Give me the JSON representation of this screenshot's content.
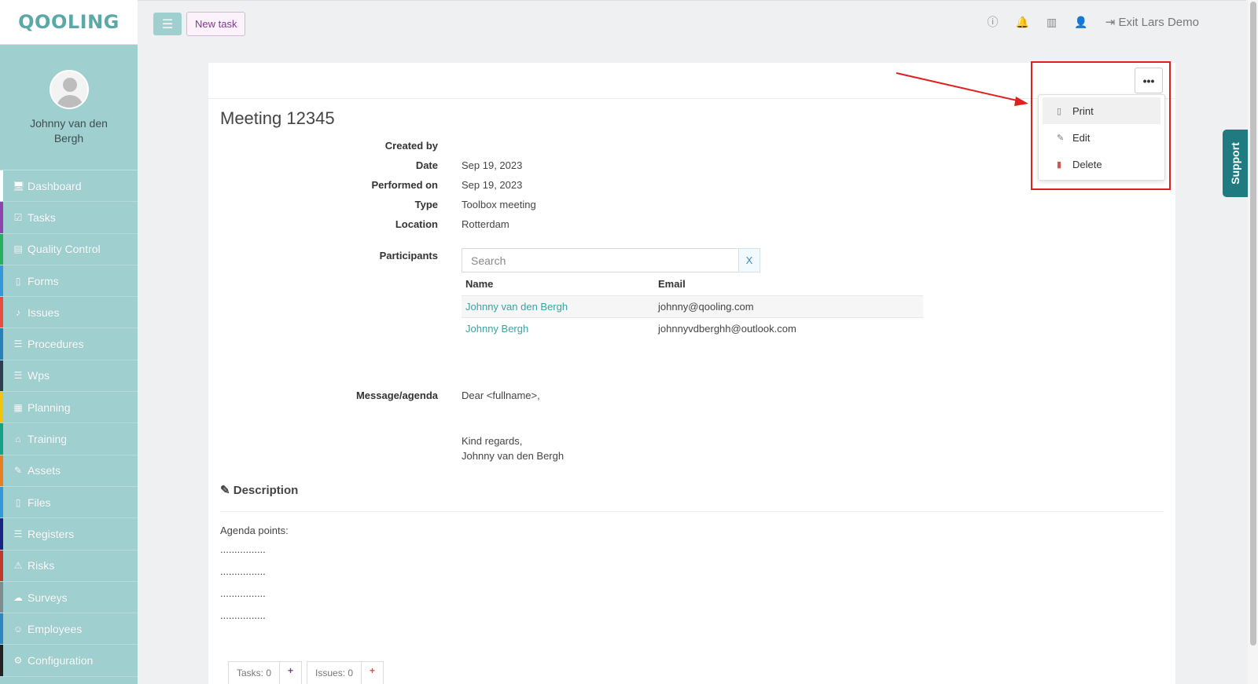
{
  "brand": {
    "logo_text": "QOOLING"
  },
  "profile": {
    "name": "Johnny van den Bergh"
  },
  "sidebar": {
    "items": [
      {
        "label": "Dashboard",
        "icon": "monitor-icon",
        "glyph": "🖥",
        "color": "#ffffff"
      },
      {
        "label": "Tasks",
        "icon": "checkbox-icon",
        "glyph": "☑",
        "color": "#8e44ad"
      },
      {
        "label": "Quality Control",
        "icon": "book-icon",
        "glyph": "▤",
        "color": "#27ae60"
      },
      {
        "label": "Forms",
        "icon": "file-icon",
        "glyph": "▯",
        "color": "#3498db"
      },
      {
        "label": "Issues",
        "icon": "bell-icon",
        "glyph": "♪",
        "color": "#e74c3c"
      },
      {
        "label": "Procedures",
        "icon": "list-icon",
        "glyph": "☰",
        "color": "#2980b9"
      },
      {
        "label": "Wps",
        "icon": "list-icon",
        "glyph": "☰",
        "color": "#2c3e50"
      },
      {
        "label": "Planning",
        "icon": "calendar-icon",
        "glyph": "▦",
        "color": "#f1c40f"
      },
      {
        "label": "Training",
        "icon": "graduation-cap-icon",
        "glyph": "⌂",
        "color": "#16a085"
      },
      {
        "label": "Assets",
        "icon": "wrench-icon",
        "glyph": "✎",
        "color": "#e67e22"
      },
      {
        "label": "Files",
        "icon": "file-icon",
        "glyph": "▯",
        "color": "#3498db"
      },
      {
        "label": "Registers",
        "icon": "list-icon",
        "glyph": "☰",
        "color": "#1a237e"
      },
      {
        "label": "Risks",
        "icon": "warning-icon",
        "glyph": "⚠",
        "color": "#c0392b"
      },
      {
        "label": "Surveys",
        "icon": "comment-icon",
        "glyph": "☁",
        "color": "#7f8c8d"
      },
      {
        "label": "Employees",
        "icon": "users-icon",
        "glyph": "☺",
        "color": "#2e86c1"
      },
      {
        "label": "Configuration",
        "icon": "gear-icon",
        "glyph": "⚙",
        "color": "#222222"
      }
    ]
  },
  "topbar": {
    "new_task_label": "New task",
    "exit_label": "Exit Lars Demo"
  },
  "meeting": {
    "title": "Meeting 12345",
    "fields": {
      "created_by_label": "Created by",
      "created_by_value": "",
      "date_label": "Date",
      "date_value": "Sep 19, 2023",
      "performed_on_label": "Performed on",
      "performed_on_value": "Sep 19, 2023",
      "type_label": "Type",
      "type_value": "Toolbox meeting",
      "location_label": "Location",
      "location_value": "Rotterdam",
      "participants_label": "Participants",
      "message_label": "Message/agenda"
    },
    "participants": {
      "search_placeholder": "Search",
      "clear_label": "X",
      "columns": [
        "Name",
        "Email"
      ],
      "rows": [
        {
          "name": "Johnny van den Bergh",
          "email": "johnny@qooling.com"
        },
        {
          "name": "Johnny Bergh",
          "email": "johnnyvdberghh@outlook.com"
        }
      ]
    },
    "message": {
      "greeting": "Dear <fullname>,",
      "closing": "Kind regards,",
      "signature": "Johnny van den Bergh"
    },
    "description": {
      "heading": "Description",
      "intro": "Agenda points:",
      "lines": [
        "................",
        "................",
        "................",
        "................"
      ]
    }
  },
  "actions_menu": {
    "more_label": "•••",
    "items": [
      {
        "label": "Print",
        "icon": "pdf-file-icon"
      },
      {
        "label": "Edit",
        "icon": "edit-icon"
      },
      {
        "label": "Delete",
        "icon": "trash-icon"
      }
    ]
  },
  "bottom_tabs": [
    {
      "label": "Tasks: 0",
      "add": "+"
    },
    {
      "label": "Issues: 0",
      "add": "+"
    }
  ],
  "support_label": "Support",
  "colors": {
    "sidebar": "#9fcfcf",
    "accent": "#3aa3a3",
    "annotation": "#e02020"
  }
}
